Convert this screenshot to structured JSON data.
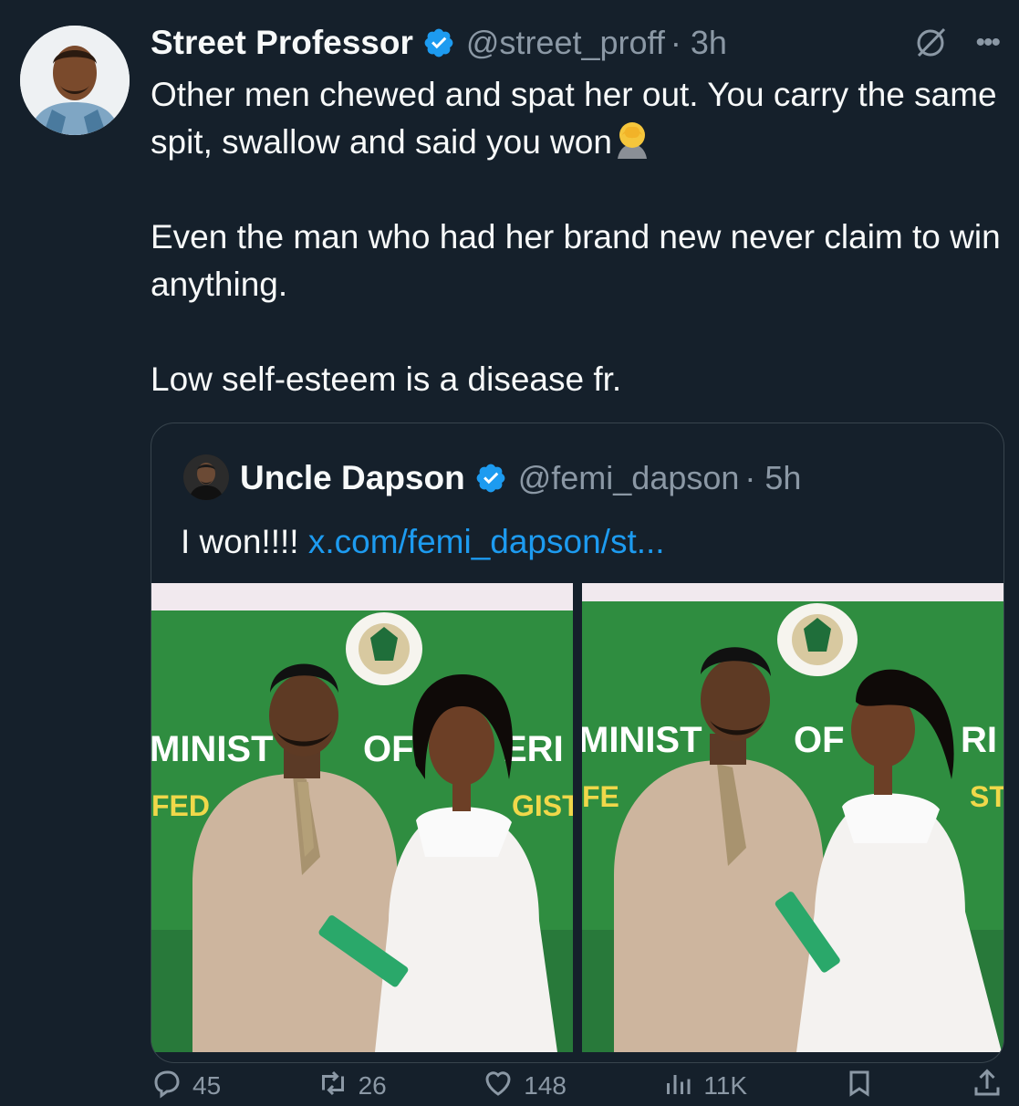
{
  "tweet": {
    "author_name": "Street Professor",
    "handle": "@street_proff",
    "time": "· 3h",
    "text": "Other men chewed and spat her out. You carry the same spit, swallow and said you won",
    "text_2": "Even the man who had her brand new never claim to win anything.",
    "text_3": "Low self-esteem is a disease fr."
  },
  "quote": {
    "author_name": "Uncle Dapson",
    "handle": "@femi_dapson",
    "time": "· 5h",
    "text": "I won!!!! ",
    "link": "x.com/femi_dapson/st..."
  },
  "photo_banner": {
    "photo_1_left": "MINIST",
    "photo_1_mid": "OF",
    "photo_1_right": "ERI",
    "photo_1_sub_left": "FED",
    "photo_1_sub_right": "GIST",
    "photo_2_left": "MINIST",
    "photo_2_mid": "OF",
    "photo_2_right": "RI",
    "photo_2_sub_left": "FE",
    "photo_2_sub_right": "ST"
  },
  "actions": {
    "replies": "45",
    "reposts": "26",
    "likes": "148",
    "views": "11K"
  },
  "icons": [
    "verified-badge-icon",
    "grok-icon",
    "more-icon",
    "facepalm-emoji",
    "reply-icon",
    "repost-icon",
    "like-icon",
    "views-icon",
    "bookmark-icon",
    "share-icon"
  ],
  "colors": {
    "background": "#15202b",
    "text": "#f7f9f9",
    "secondary": "#8b98a5",
    "link": "#1d9bf0",
    "verified": "#1d9bf0"
  }
}
